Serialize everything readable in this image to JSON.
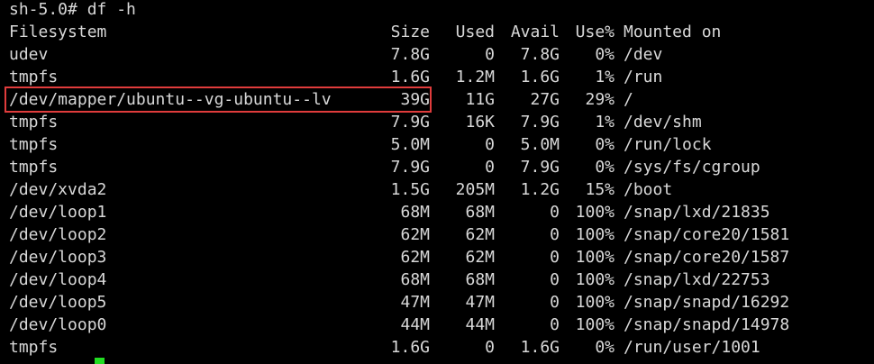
{
  "terminal": {
    "prompt": "sh-5.0# df -h",
    "headers": {
      "filesystem": "Filesystem",
      "size": "Size",
      "used": "Used",
      "avail": "Avail",
      "use_pct": "Use%",
      "mounted": "Mounted on"
    },
    "rows": [
      {
        "fs": "udev",
        "size": "7.8G",
        "used": "0",
        "avail": "7.8G",
        "use": "0%",
        "mnt": "/dev"
      },
      {
        "fs": "tmpfs",
        "size": "1.6G",
        "used": "1.2M",
        "avail": "1.6G",
        "use": "1%",
        "mnt": "/run"
      },
      {
        "fs": "/dev/mapper/ubuntu--vg-ubuntu--lv",
        "size": "39G",
        "used": "11G",
        "avail": "27G",
        "use": "29%",
        "mnt": "/"
      },
      {
        "fs": "tmpfs",
        "size": "7.9G",
        "used": "16K",
        "avail": "7.9G",
        "use": "1%",
        "mnt": "/dev/shm"
      },
      {
        "fs": "tmpfs",
        "size": "5.0M",
        "used": "0",
        "avail": "5.0M",
        "use": "0%",
        "mnt": "/run/lock"
      },
      {
        "fs": "tmpfs",
        "size": "7.9G",
        "used": "0",
        "avail": "7.9G",
        "use": "0%",
        "mnt": "/sys/fs/cgroup"
      },
      {
        "fs": "/dev/xvda2",
        "size": "1.5G",
        "used": "205M",
        "avail": "1.2G",
        "use": "15%",
        "mnt": "/boot"
      },
      {
        "fs": "/dev/loop1",
        "size": "68M",
        "used": "68M",
        "avail": "0",
        "use": "100%",
        "mnt": "/snap/lxd/21835"
      },
      {
        "fs": "/dev/loop2",
        "size": "62M",
        "used": "62M",
        "avail": "0",
        "use": "100%",
        "mnt": "/snap/core20/1581"
      },
      {
        "fs": "/dev/loop3",
        "size": "62M",
        "used": "62M",
        "avail": "0",
        "use": "100%",
        "mnt": "/snap/core20/1587"
      },
      {
        "fs": "/dev/loop4",
        "size": "68M",
        "used": "68M",
        "avail": "0",
        "use": "100%",
        "mnt": "/snap/lxd/22753"
      },
      {
        "fs": "/dev/loop5",
        "size": "47M",
        "used": "47M",
        "avail": "0",
        "use": "100%",
        "mnt": "/snap/snapd/16292"
      },
      {
        "fs": "/dev/loop0",
        "size": "44M",
        "used": "44M",
        "avail": "0",
        "use": "100%",
        "mnt": "/snap/snapd/14978"
      },
      {
        "fs": "tmpfs",
        "size": "1.6G",
        "used": "0",
        "avail": "1.6G",
        "use": "0%",
        "mnt": "/run/user/1001"
      }
    ],
    "highlighted_row_index": 2,
    "colors": {
      "background": "#000000",
      "text": "#d8d8d8",
      "highlight_border": "#e03c3c",
      "cursor": "#22dd22"
    }
  }
}
